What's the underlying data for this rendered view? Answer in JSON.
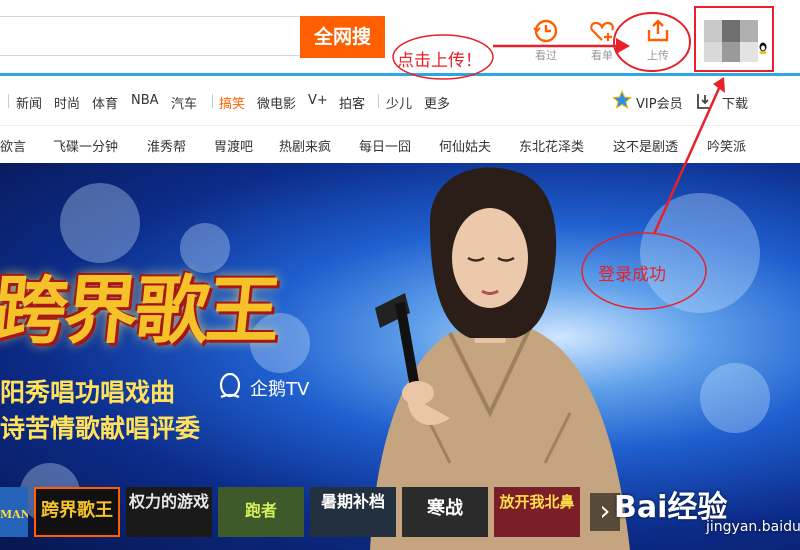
{
  "header": {
    "search_button": "全网搜",
    "tools": [
      {
        "label": "看过",
        "icon": "history-clock-icon"
      },
      {
        "label": "看单",
        "icon": "heart-plus-icon"
      },
      {
        "label": "上传",
        "icon": "upload-icon"
      }
    ],
    "accent_color": "#ff5f00",
    "line_color": "#2ea7e0"
  },
  "nav": {
    "items": [
      "新闻",
      "时尚",
      "体育",
      "NBA",
      "汽车",
      "搞笑",
      "微电影",
      "V+",
      "拍客",
      "少儿",
      "更多"
    ],
    "active": "搞笑",
    "vip_label": "VIP会员",
    "download_label": "下载"
  },
  "subnav": {
    "items": [
      "欲言",
      "飞碟一分钟",
      "淮秀帮",
      "胃渡吧",
      "热剧来疯",
      "每日一囧",
      "何仙姑夫",
      "东北花泽类",
      "这不是剧透",
      "吟笑派"
    ]
  },
  "banner": {
    "show_title": "跨界歌王",
    "tagline1": "阳秀唱功唱戏曲",
    "tagline2": "诗苦情歌献唱评委",
    "tv_brand": "企鹅TV"
  },
  "thumbnails": [
    {
      "text": "MAN"
    },
    {
      "text": "跨界歌王"
    },
    {
      "text": "权力的游戏"
    },
    {
      "text": "跑者"
    },
    {
      "text": "暑期补档"
    },
    {
      "text": "寒战"
    },
    {
      "text": "放开我北鼻"
    }
  ],
  "annotations": {
    "upload_note": "点击上传！",
    "login_note": "登录成功",
    "color": "#e8202b"
  },
  "watermark": {
    "main": "Bai经验",
    "sub": "jingyan.baidu.com"
  }
}
